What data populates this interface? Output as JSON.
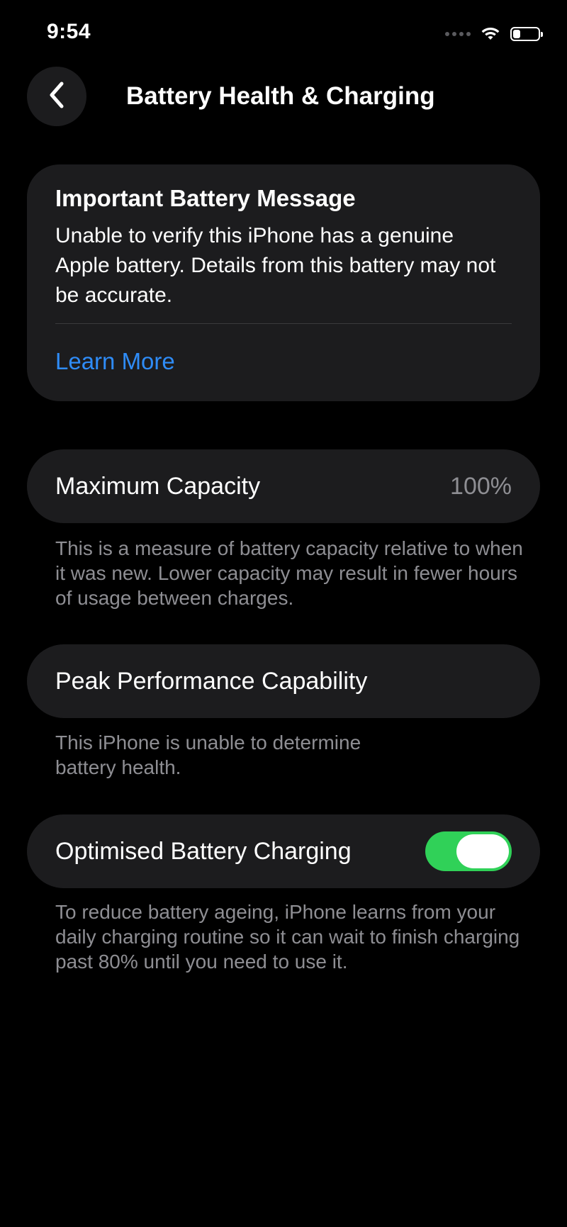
{
  "status_bar": {
    "time": "9:54",
    "signal_icon": "cellular-no-signal-icon",
    "wifi_icon": "wifi-icon",
    "battery_icon": "battery-icon",
    "battery_level_fraction": 0.3
  },
  "nav": {
    "back_icon": "chevron-left-icon",
    "title": "Battery Health & Charging"
  },
  "battery_message": {
    "title": "Important Battery Message",
    "body": "Unable to verify this iPhone has a genuine Apple battery. Details from this battery may not be accurate.",
    "link_label": "Learn More",
    "link_color": "#2f8cf7"
  },
  "maximum_capacity": {
    "label": "Maximum Capacity",
    "value": "100%",
    "footnote": "This is a measure of battery capacity relative to when it was new. Lower capacity may result in fewer hours of usage between charges."
  },
  "peak_performance": {
    "label": "Peak Performance Capability",
    "footnote": "This iPhone is unable to determine battery health."
  },
  "optimised_charging": {
    "label": "Optimised Battery Charging",
    "enabled": true,
    "toggle_color": "#30d158",
    "footnote": "To reduce battery ageing, iPhone learns from your daily charging routine so it can wait to finish charging past 80% until you need to use it."
  },
  "colors": {
    "background": "#000000",
    "card": "#1c1c1e",
    "secondary_text": "#8e8e93"
  }
}
